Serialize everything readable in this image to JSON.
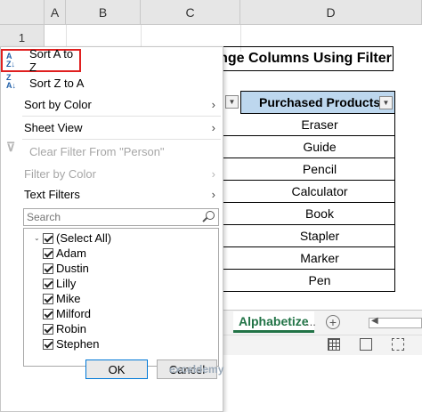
{
  "grid": {
    "columns": [
      "A",
      "B",
      "C",
      "D"
    ],
    "rows": [
      "1"
    ]
  },
  "sheet": {
    "title_fragment": "nge Columns Using Filter",
    "table_header": "Purchased Products",
    "products": [
      "Eraser",
      "Guide",
      "Pencil",
      "Calculator",
      "Book",
      "Stapler",
      "Marker",
      "Pen"
    ],
    "tab_name": "Alphabetize",
    "ellipsis": "...",
    "add_sheet_symbol": "+"
  },
  "menu": {
    "sort_az": "Sort A to Z",
    "sort_za": "Sort Z to A",
    "sort_by_color": "Sort by Color",
    "sheet_view": "Sheet View",
    "clear_filter": "Clear Filter From \"Person\"",
    "filter_by_color": "Filter by Color",
    "text_filters": "Text Filters",
    "search_placeholder": "Search",
    "items": [
      "(Select All)",
      "Adam",
      "Dustin",
      "Lilly",
      "Mike",
      "Milford",
      "Robin",
      "Stephen"
    ],
    "ok": "OK",
    "cancel": "Cancel"
  },
  "watermark": "exceldemy",
  "colors": {
    "header_fill": "#bdd7ee",
    "highlight": "#e02020",
    "excel_green": "#217346"
  }
}
